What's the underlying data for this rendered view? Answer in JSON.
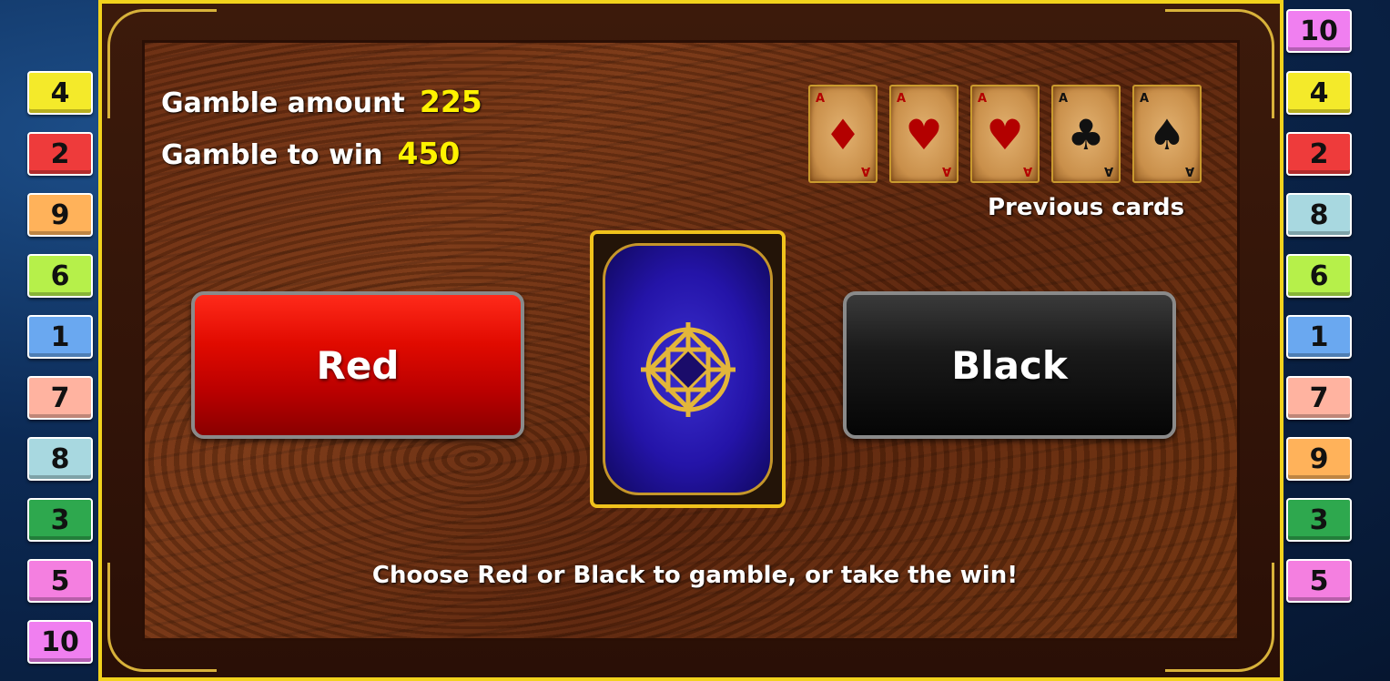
{
  "left_lines": [
    {
      "label": "4",
      "color": "#f4ea2a"
    },
    {
      "label": "2",
      "color": "#ee3b3b"
    },
    {
      "label": "9",
      "color": "#ffb25a"
    },
    {
      "label": "6",
      "color": "#b6f04a"
    },
    {
      "label": "1",
      "color": "#6aa8f0"
    },
    {
      "label": "7",
      "color": "#ffb3a0"
    },
    {
      "label": "8",
      "color": "#a8d8e0"
    },
    {
      "label": "3",
      "color": "#2ea84e"
    },
    {
      "label": "5",
      "color": "#f47fe0"
    },
    {
      "label": "10",
      "color": "#f07ff0"
    }
  ],
  "right_lines": [
    {
      "label": "10",
      "color": "#f07ff0"
    },
    {
      "label": "4",
      "color": "#f4ea2a"
    },
    {
      "label": "2",
      "color": "#ee3b3b"
    },
    {
      "label": "8",
      "color": "#a8d8e0"
    },
    {
      "label": "6",
      "color": "#b6f04a"
    },
    {
      "label": "1",
      "color": "#6aa8f0"
    },
    {
      "label": "7",
      "color": "#ffb3a0"
    },
    {
      "label": "9",
      "color": "#ffb25a"
    },
    {
      "label": "3",
      "color": "#2ea84e"
    },
    {
      "label": "5",
      "color": "#f47fe0"
    }
  ],
  "gamble": {
    "amount_label": "Gamble amount",
    "amount_value": "225",
    "win_label": "Gamble to win",
    "win_value": "450"
  },
  "previous_cards": {
    "label": "Previous cards",
    "cards": [
      {
        "rank": "A",
        "suit": "♦",
        "suit_name": "diamonds",
        "color": "red"
      },
      {
        "rank": "A",
        "suit": "♥",
        "suit_name": "hearts",
        "color": "red"
      },
      {
        "rank": "A",
        "suit": "♥",
        "suit_name": "hearts",
        "color": "red"
      },
      {
        "rank": "A",
        "suit": "♣",
        "suit_name": "clubs",
        "color": "black"
      },
      {
        "rank": "A",
        "suit": "♠",
        "suit_name": "spades",
        "color": "black"
      }
    ]
  },
  "buttons": {
    "red_label": "Red",
    "black_label": "Black"
  },
  "message": "Choose Red or Black to gamble, or take the win!",
  "colors": {
    "frame_gold": "#f2d21c",
    "value_yellow": "#fff200",
    "red_button": "#e00a00",
    "black_button": "#111111",
    "card_back_blue": "#2414a8"
  }
}
